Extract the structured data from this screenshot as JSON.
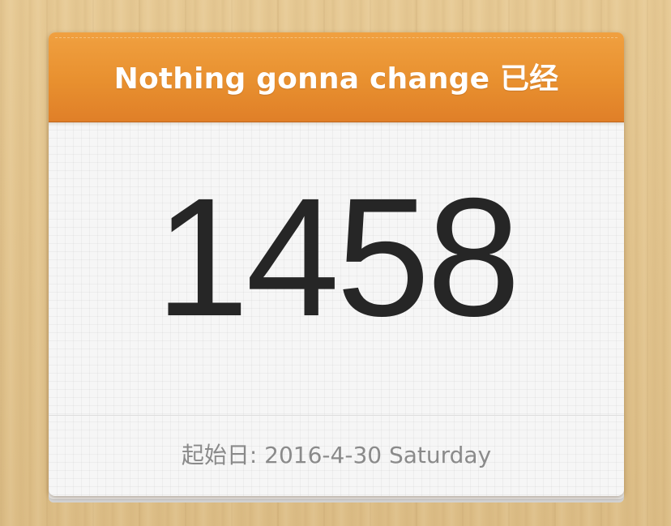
{
  "card": {
    "title": "Nothing gonna change 已经",
    "day_count": "1458",
    "start_date_text": "起始日: 2016-4-30 Saturday"
  },
  "colors": {
    "header": "#e8902f",
    "counter_text": "#262626",
    "footer_text": "#8a8a8a"
  }
}
